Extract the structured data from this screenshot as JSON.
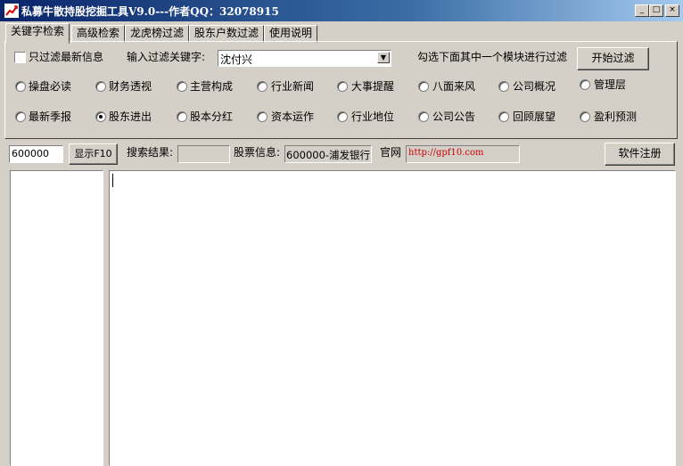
{
  "window": {
    "title": "私募牛散持股挖掘工具V9.0---作者QQ：32078915",
    "min_glyph": "_",
    "max_glyph": "□",
    "close_glyph": "×"
  },
  "tabs": [
    {
      "label": "关键字检索",
      "active": true
    },
    {
      "label": "高级检索"
    },
    {
      "label": "龙虎榜过滤"
    },
    {
      "label": "股东户数过滤"
    },
    {
      "label": "使用说明"
    }
  ],
  "filter": {
    "only_latest_label": "只过滤最新信息",
    "only_latest_checked": false,
    "keyword_label": "输入过滤关键字:",
    "keyword_value": "沈付兴",
    "hint": "勾选下面其中一个模块进行过滤",
    "start_button": "开始过滤"
  },
  "modules": [
    {
      "label": "操盘必读",
      "checked": false
    },
    {
      "label": "财务透视",
      "checked": false
    },
    {
      "label": "主营构成",
      "checked": false
    },
    {
      "label": "行业新闻",
      "checked": false
    },
    {
      "label": "大事提醒",
      "checked": false
    },
    {
      "label": "八面来风",
      "checked": false
    },
    {
      "label": "公司概况",
      "checked": false
    },
    {
      "label": "管理层",
      "checked": false
    },
    {
      "label": "最新季报",
      "checked": false
    },
    {
      "label": "股东进出",
      "checked": true
    },
    {
      "label": "股本分红",
      "checked": false
    },
    {
      "label": "资本运作",
      "checked": false
    },
    {
      "label": "行业地位",
      "checked": false
    },
    {
      "label": "公司公告",
      "checked": false
    },
    {
      "label": "回顾展望",
      "checked": false
    },
    {
      "label": "盈利预测",
      "checked": false
    }
  ],
  "toolbar": {
    "code_value": "600000",
    "show_f10_button": "显示F10",
    "search_result_label": "搜索结果:",
    "search_result_value": "",
    "stock_info_label": "股票信息:",
    "stock_info_value": "600000-浦发银行",
    "website_label": "官网",
    "website_url": "http://gpf10.com",
    "register_button": "软件注册"
  },
  "colors": {
    "title_bar": "#0a246a",
    "face": "#d4d0c8",
    "link_red": "#cc0000"
  }
}
